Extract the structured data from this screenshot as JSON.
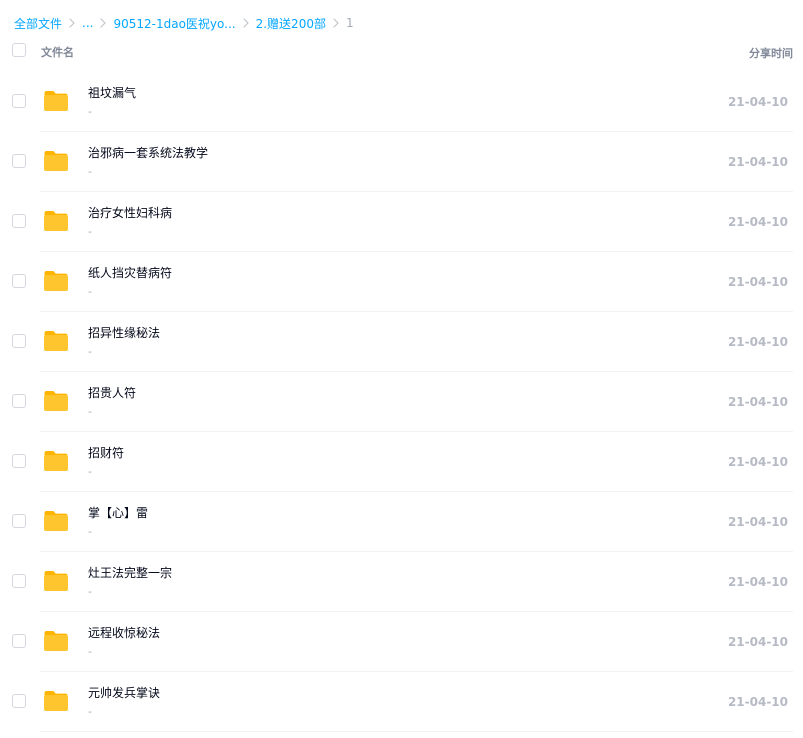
{
  "breadcrumb": [
    {
      "label": "全部文件",
      "link": true
    },
    {
      "label": "...",
      "link": true
    },
    {
      "label": "90512-1dao医祝yo...",
      "link": true
    },
    {
      "label": "2.赠送200部",
      "link": true
    },
    {
      "label": "1",
      "link": false
    }
  ],
  "header": {
    "name_label": "文件名",
    "time_label": "分享时间"
  },
  "files": [
    {
      "name": "祖坟漏气",
      "sub": "-",
      "time": "21-04-10"
    },
    {
      "name": "治邪病一套系统法教学",
      "sub": "-",
      "time": "21-04-10"
    },
    {
      "name": "治疗女性妇科病",
      "sub": "-",
      "time": "21-04-10"
    },
    {
      "name": "纸人挡灾替病符",
      "sub": "-",
      "time": "21-04-10"
    },
    {
      "name": "招异性缘秘法",
      "sub": "-",
      "time": "21-04-10"
    },
    {
      "name": "招贵人符",
      "sub": "-",
      "time": "21-04-10"
    },
    {
      "name": "招财符",
      "sub": "-",
      "time": "21-04-10"
    },
    {
      "name": "掌【心】雷",
      "sub": "-",
      "time": "21-04-10"
    },
    {
      "name": "灶王法完整一宗",
      "sub": "-",
      "time": "21-04-10"
    },
    {
      "name": "远程收惊秘法",
      "sub": "-",
      "time": "21-04-10"
    },
    {
      "name": "元帅发兵掌诀",
      "sub": "-",
      "time": "21-04-10"
    }
  ],
  "icons": {
    "row_icon": "folder-icon",
    "separator_icon": "chevron-right-icon"
  },
  "colors": {
    "link": "#06a7ff",
    "folder": "#ffc52e",
    "folder_back": "#ffb500"
  }
}
